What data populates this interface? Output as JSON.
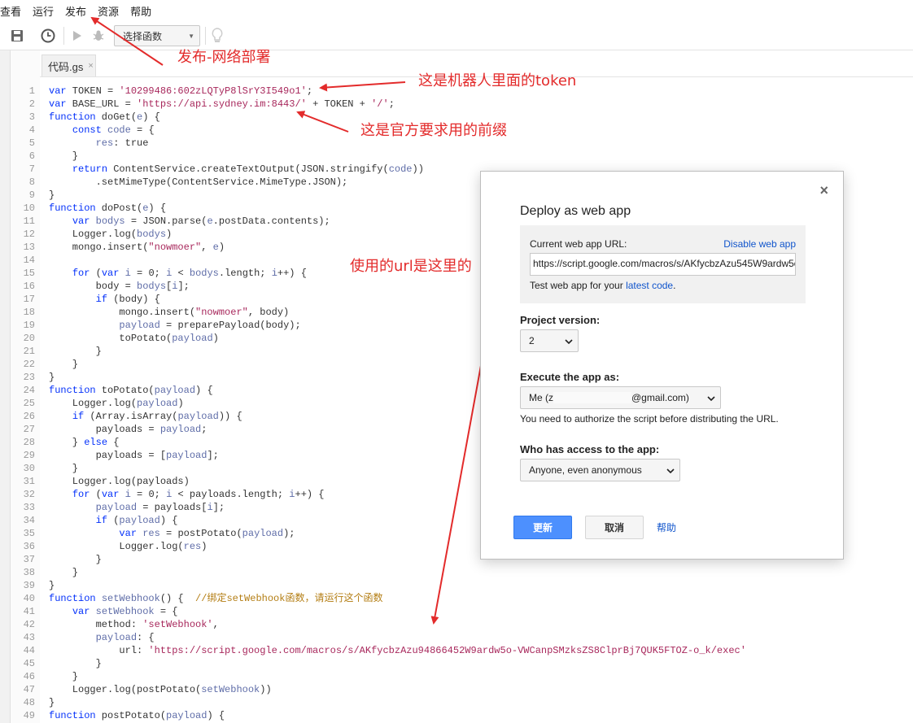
{
  "menu": [
    "查看",
    "运行",
    "发布",
    "资源",
    "帮助"
  ],
  "toolbar": {
    "function_select": "选择函数"
  },
  "tab": {
    "label": "代码.gs",
    "close": "×"
  },
  "code": [
    {
      "n": "1",
      "t": "var TOKEN = '10299486:602zLQTyP8lSrY3I549o1';"
    },
    {
      "n": "2",
      "t": "var BASE_URL = 'https://api.sydney.im:8443/' + TOKEN + '/';"
    },
    {
      "n": "3",
      "t": "function doGet(e) {"
    },
    {
      "n": "4",
      "t": "    const code = {"
    },
    {
      "n": "5",
      "t": "        res: true"
    },
    {
      "n": "6",
      "t": "    }"
    },
    {
      "n": "7",
      "t": "    return ContentService.createTextOutput(JSON.stringify(code))"
    },
    {
      "n": "8",
      "t": "        .setMimeType(ContentService.MimeType.JSON);"
    },
    {
      "n": "9",
      "t": "}"
    },
    {
      "n": "10",
      "t": "function doPost(e) {"
    },
    {
      "n": "11",
      "t": "    var bodys = JSON.parse(e.postData.contents);"
    },
    {
      "n": "12",
      "t": "    Logger.log(bodys)"
    },
    {
      "n": "13",
      "t": "    mongo.insert(\"nowmoer\", e)"
    },
    {
      "n": "14",
      "t": ""
    },
    {
      "n": "15",
      "t": "    for (var i = 0; i < bodys.length; i++) {"
    },
    {
      "n": "16",
      "t": "        body = bodys[i];"
    },
    {
      "n": "17",
      "t": "        if (body) {"
    },
    {
      "n": "18",
      "t": "            mongo.insert(\"nowmoer\", body)"
    },
    {
      "n": "19",
      "t": "            payload = preparePayload(body);"
    },
    {
      "n": "20",
      "t": "            toPotato(payload)"
    },
    {
      "n": "21",
      "t": "        }"
    },
    {
      "n": "22",
      "t": "    }"
    },
    {
      "n": "23",
      "t": "}"
    },
    {
      "n": "24",
      "t": "function toPotato(payload) {"
    },
    {
      "n": "25",
      "t": "    Logger.log(payload)"
    },
    {
      "n": "26",
      "t": "    if (Array.isArray(payload)) {"
    },
    {
      "n": "27",
      "t": "        payloads = payload;"
    },
    {
      "n": "28",
      "t": "    } else {"
    },
    {
      "n": "29",
      "t": "        payloads = [payload];"
    },
    {
      "n": "30",
      "t": "    }"
    },
    {
      "n": "31",
      "t": "    Logger.log(payloads)"
    },
    {
      "n": "32",
      "t": "    for (var i = 0; i < payloads.length; i++) {"
    },
    {
      "n": "33",
      "t": "        payload = payloads[i];"
    },
    {
      "n": "34",
      "t": "        if (payload) {"
    },
    {
      "n": "35",
      "t": "            var res = postPotato(payload);"
    },
    {
      "n": "36",
      "t": "            Logger.log(res)"
    },
    {
      "n": "37",
      "t": "        }"
    },
    {
      "n": "38",
      "t": "    }"
    },
    {
      "n": "39",
      "t": "}"
    },
    {
      "n": "40",
      "t": "function setWebhook() {  //绑定setWebhook函数，请运行这个函数"
    },
    {
      "n": "41",
      "t": "    var setWebhook = {"
    },
    {
      "n": "42",
      "t": "        method: 'setWebhook',"
    },
    {
      "n": "43",
      "t": "        payload: {"
    },
    {
      "n": "44",
      "t": "            url: 'https://script.google.com/macros/s/AKfycbzAzu94866452W9ardw5o-VWCanpSMzksZS8ClprBj7QUK5FTOZ-o_k/exec'"
    },
    {
      "n": "45",
      "t": "        }"
    },
    {
      "n": "46",
      "t": "    }"
    },
    {
      "n": "47",
      "t": "    Logger.log(postPotato(setWebhook))"
    },
    {
      "n": "48",
      "t": "}"
    },
    {
      "n": "49",
      "t": "function postPotato(payload) {"
    }
  ],
  "annotations": {
    "publish": "发布-网络部署",
    "token": "这是机器人里面的token",
    "prefix": "这是官方要求用的前缀",
    "url": "使用的url是这里的"
  },
  "dialog": {
    "close": "×",
    "title": "Deploy as web app",
    "current_url_label": "Current web app URL:",
    "disable_link": "Disable web app",
    "url_value": "https://script.google.com/macros/s/AKfycbzAzu545W9ardw5o",
    "test_prefix": "Test web app for your ",
    "test_link": "latest code",
    "test_suffix": ".",
    "project_version_label": "Project version:",
    "project_version_value": "2",
    "execute_label": "Execute the app as:",
    "execute_prefix": "Me (z",
    "execute_suffix": "@gmail.com)",
    "authorize_note": "You need to authorize the script before distributing the URL.",
    "access_label": "Who has access to the app:",
    "access_value": "Anyone, even anonymous",
    "update_button": "更新",
    "cancel_button": "取消",
    "help_link": "帮助"
  },
  "colors": {
    "annotation": "#e32b2b",
    "primary": "#4d90fe",
    "link": "#1155cc"
  }
}
